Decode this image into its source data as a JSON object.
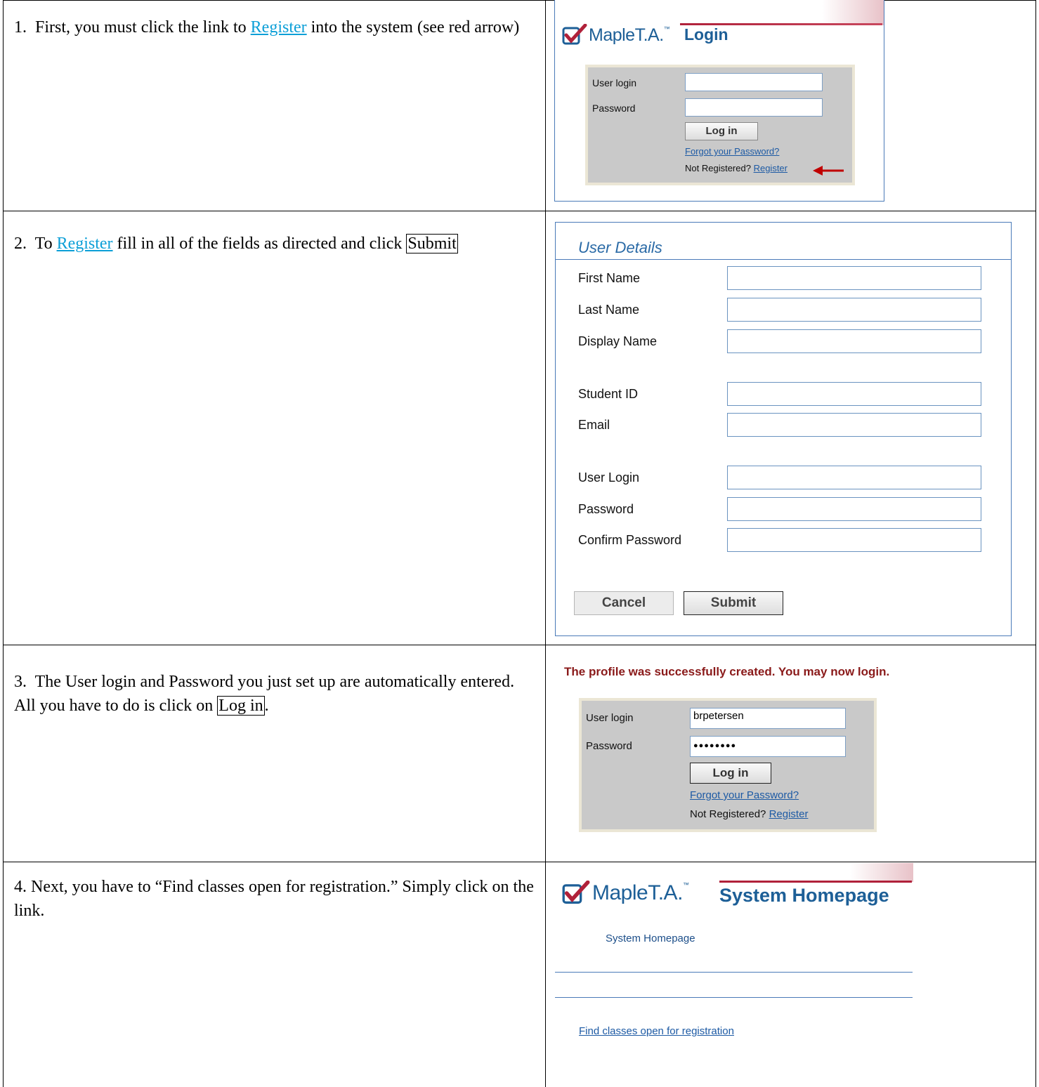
{
  "steps": [
    {
      "num": "1.",
      "before": "First, you must click the link to ",
      "link": "Register",
      "after": " into the system (see red arrow)"
    },
    {
      "num": "2.",
      "before": "To ",
      "link": "Register",
      "after": " fill in all of the fields as directed and click ",
      "boxed": "Submit"
    },
    {
      "num": "3.",
      "before": "The User login and Password you just set up are automatically entered.  All you have to do is click on ",
      "boxed": "Log in",
      "after": "."
    },
    {
      "num": "4.",
      "before": "Next, you have to “Find classes open for registration.” Simply click on the link."
    }
  ],
  "logo": {
    "maple": "Maple",
    "ta": "T.A.",
    "tm": "™"
  },
  "login_panel": {
    "title": "Login",
    "user_label": "User login",
    "password_label": "Password",
    "login_button": "Log in",
    "forgot_link": "Forgot your Password?",
    "not_registered": "Not Registered?",
    "register_link": "Register",
    "arrow_color": "#c00000"
  },
  "user_details": {
    "title": "User Details",
    "fields": [
      "First Name",
      "Last Name",
      "Display Name",
      "Student ID",
      "Email",
      "User Login",
      "Password",
      "Confirm Password"
    ],
    "cancel_button": "Cancel",
    "submit_button": "Submit"
  },
  "success_panel": {
    "message": "The profile was successfully created. You may now login.",
    "user_label": "User login",
    "password_label": "Password",
    "user_value": "brpetersen",
    "password_value": "●●●●●●●●",
    "login_button": "Log in",
    "forgot_link": "Forgot your Password?",
    "not_registered": "Not Registered?",
    "register_link": "Register"
  },
  "homepage_panel": {
    "title": "System Homepage",
    "breadcrumb": "System Homepage",
    "find_link": "Find classes open for registration"
  },
  "colors": {
    "brand_blue": "#1d5f97",
    "link_blue": "#0c9fd7",
    "brand_red": "#b0213a",
    "message_red": "#8a1a1a"
  }
}
